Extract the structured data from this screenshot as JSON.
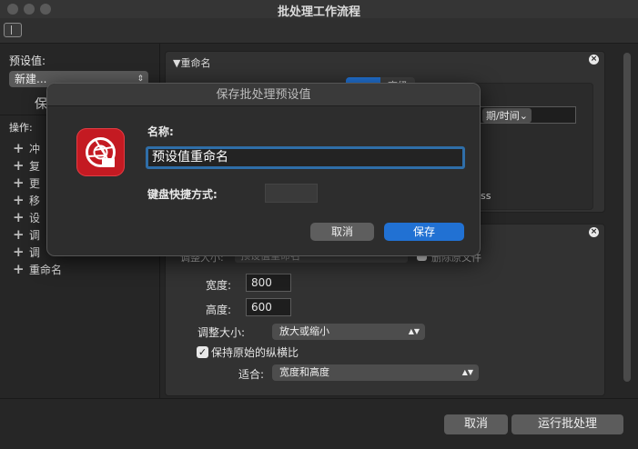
{
  "window": {
    "title": "批处理工作流程"
  },
  "sidebar": {
    "preset_label": "预设值:",
    "preset_value": "新建...",
    "save_partial": "保",
    "ops_label": "操作:",
    "ops": [
      "冲",
      "复",
      "更",
      "移",
      "设",
      "调",
      "调",
      "重命名"
    ]
  },
  "rename_panel": {
    "title": "▼重命名",
    "tab_partial": "高级",
    "date_popup": "期/时间",
    "suffix_partial": "ss"
  },
  "resize_panel": {
    "partial_row_left": "调整大小:",
    "partial_row_mid": "预设值重命名",
    "partial_row_right": "删除原文件",
    "width_label": "宽度:",
    "width_value": "800",
    "height_label": "高度:",
    "height_value": "600",
    "resize_label": "调整大小:",
    "resize_value": "放大或缩小",
    "keep_ratio_label": "保持原始的纵横比",
    "fit_label": "适合:",
    "fit_value": "宽度和高度"
  },
  "footer": {
    "cancel": "取消",
    "run": "运行批处理"
  },
  "dialog": {
    "title": "保存批处理预设值",
    "name_label": "名称:",
    "name_value": "预设值重命名",
    "shortcut_label": "键盘快捷方式:",
    "cancel": "取消",
    "save": "保存"
  },
  "colors": {
    "accent": "#2171d3",
    "focus_ring": "#2f6ea8",
    "app_icon": "#c41a22"
  },
  "icons": {
    "sidebar_toggle": "sidebar-icon",
    "app": "aperture-icon",
    "close": "close-icon"
  }
}
